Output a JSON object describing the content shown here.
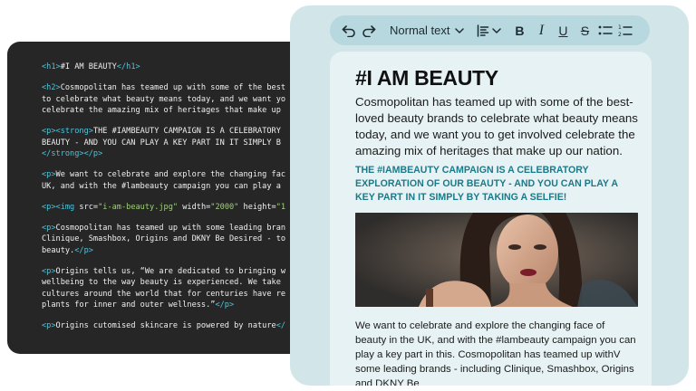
{
  "code": {
    "lines": [
      [
        {
          "t": "<h1>",
          "c": "tag"
        },
        {
          "t": "#I AM BEAUTY",
          "c": "attr"
        },
        {
          "t": "</h1>",
          "c": "tag"
        }
      ],
      [],
      [
        {
          "t": "<h2>",
          "c": "tag"
        },
        {
          "t": "Cosmopolitan has teamed up with some of the best",
          "c": "attr"
        }
      ],
      [
        {
          "t": "to celebrate what beauty means today, and we want yo",
          "c": "attr"
        }
      ],
      [
        {
          "t": "celebrate the amazing mix of heritages that make up",
          "c": "attr"
        }
      ],
      [],
      [
        {
          "t": "<p>",
          "c": "tag"
        },
        {
          "t": "<strong>",
          "c": "tag"
        },
        {
          "t": "THE #IAMBEAUTY CAMPAIGN IS A CELEBRATORY",
          "c": "attr"
        }
      ],
      [
        {
          "t": "BEAUTY - AND YOU CAN PLAY A KEY PART IN IT SIMPLY B",
          "c": "attr"
        }
      ],
      [
        {
          "t": "</strong>",
          "c": "tag"
        },
        {
          "t": "</p>",
          "c": "tag"
        }
      ],
      [],
      [
        {
          "t": "<p>",
          "c": "tag"
        },
        {
          "t": "We want to celebrate and explore the changing fac",
          "c": "attr"
        }
      ],
      [
        {
          "t": "UK, and with the #lambeauty campaign you can play a",
          "c": "attr"
        }
      ],
      [],
      [
        {
          "t": "<p>",
          "c": "tag"
        },
        {
          "t": "<img ",
          "c": "tag"
        },
        {
          "t": "src=",
          "c": "attr"
        },
        {
          "t": "\"i-am-beauty.jpg\"",
          "c": "str"
        },
        {
          "t": " width=",
          "c": "attr"
        },
        {
          "t": "\"2000\"",
          "c": "str"
        },
        {
          "t": " height=",
          "c": "attr"
        },
        {
          "t": "\"1",
          "c": "str"
        }
      ],
      [],
      [
        {
          "t": "<p>",
          "c": "tag"
        },
        {
          "t": "Cosmopolitan has teamed up with some leading bran",
          "c": "attr"
        }
      ],
      [
        {
          "t": "Clinique, Smashbox, Origins and DKNY Be Desired - to",
          "c": "attr"
        }
      ],
      [
        {
          "t": "beauty.",
          "c": "attr"
        },
        {
          "t": "</p>",
          "c": "tag"
        }
      ],
      [],
      [
        {
          "t": "<p>",
          "c": "tag"
        },
        {
          "t": "Origins tells us, “We are dedicated to bringing w",
          "c": "attr"
        }
      ],
      [
        {
          "t": "wellbeing to the way beauty is experienced. We take",
          "c": "attr"
        }
      ],
      [
        {
          "t": "cultures around the world that for centuries have re",
          "c": "attr"
        }
      ],
      [
        {
          "t": "plants for inner and outer wellness.”",
          "c": "attr"
        },
        {
          "t": "</p>",
          "c": "tag"
        }
      ],
      [],
      [
        {
          "t": "<p>",
          "c": "tag"
        },
        {
          "t": "Origins cutomised skincare is powered by nature",
          "c": "attr"
        },
        {
          "t": "</",
          "c": "tag"
        }
      ]
    ]
  },
  "toolbar": {
    "text_style": "Normal text",
    "bold": "B",
    "italic": "I",
    "underline": "U",
    "strikethrough": "S"
  },
  "document": {
    "title": "#I AM BEAUTY",
    "intro": "Cosmopolitan has teamed up with some of the best-loved beauty brands to celebrate what beauty means today, and we want you to get involved celebrate the amazing mix of heritages that make up our nation.",
    "campaign": "THE #IAMBEAUTY CAMPAIGN IS A CELEBRATORY EXPLORATION OF OUR BEAUTY - AND YOU CAN PLAY A KEY PART IN IT SIMPLY BY TAKING A SELFIE!",
    "body": "We want to celebrate and explore the changing face of beauty in the UK, and with the #lambeauty campaign you can play a key part in this. Cosmopolitan has teamed up withV some leading brands - including Clinique, Smashbox, Origins and DKNY Be"
  },
  "colors": {
    "code_bg": "#262626",
    "code_tag": "#4fc3d9",
    "code_string": "#9fd07a",
    "editor_bg": "#d2e6ea",
    "toolbar_bg": "#b7d8de",
    "doc_bg": "#e7f2f4",
    "campaign_text": "#1a7a8a"
  }
}
